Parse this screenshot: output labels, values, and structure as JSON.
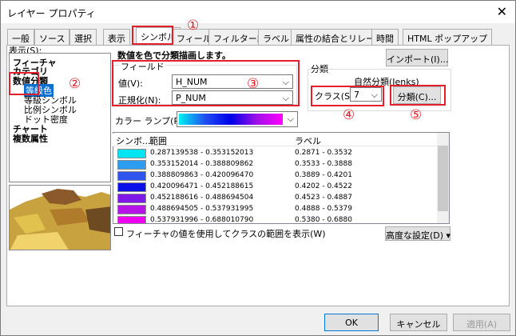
{
  "window": {
    "title": "レイヤー プロパティ"
  },
  "tabs": [
    "一般",
    "ソース",
    "選択",
    "表示",
    "シンボル",
    "フィールド",
    "フィルター設定",
    "ラベル",
    "属性の結合とリレート",
    "時間",
    "HTML ポップアップ"
  ],
  "display_label": "表示(S):",
  "tree": {
    "items": [
      "フィーチャ",
      "カテゴリ",
      "数値分類",
      "等級色",
      "等級シンボル",
      "比例シンボル",
      "ドット密度",
      "チャート",
      "複数属性"
    ]
  },
  "heading": "数値を色で分類描画します。",
  "import_label": "インポート(I)...",
  "field_group": {
    "title": "フィールド",
    "value_label": "値(V):",
    "value": "H_NUM",
    "norm_label": "正規化(N):",
    "norm": "P_NUM"
  },
  "class_group": {
    "title": "分類",
    "method": "自然分類(Jenks)",
    "classes_label": "クラス(S):",
    "classes": "7",
    "classify_label": "分類(C)..."
  },
  "ramp_label": "カラー ランプ(R):",
  "list": {
    "headers": [
      "シンボ...",
      "範囲",
      "ラベル"
    ],
    "rows": [
      {
        "color": "#00e5f2",
        "range": "0.287139538 - 0.353152013",
        "label": "0.2871 - 0.3532"
      },
      {
        "color": "#2d9df0",
        "range": "0.353152014 - 0.388809862",
        "label": "0.3533 - 0.3888"
      },
      {
        "color": "#2f55ee",
        "range": "0.388809863 - 0.420096470",
        "label": "0.3889 - 0.4201"
      },
      {
        "color": "#0a10e8",
        "range": "0.420096471 - 0.452188615",
        "label": "0.4202 - 0.4522"
      },
      {
        "color": "#7f18e8",
        "range": "0.452188616 - 0.488694504",
        "label": "0.4523 - 0.4887"
      },
      {
        "color": "#b515e8",
        "range": "0.488694505 - 0.537931995",
        "label": "0.4888 - 0.5379"
      },
      {
        "color": "#f000f0",
        "range": "0.537931996 - 0.688010790",
        "label": "0.5380 - 0.6880"
      }
    ]
  },
  "show_range_checkbox": "フィーチャの値を使用してクラスの範囲を表示(W)",
  "advanced_label": "高度な設定(D) ▾",
  "buttons": {
    "ok": "OK",
    "cancel": "キャンセル",
    "apply": "適用(A)"
  },
  "markers": [
    "①",
    "②",
    "③",
    "④",
    "⑤"
  ]
}
